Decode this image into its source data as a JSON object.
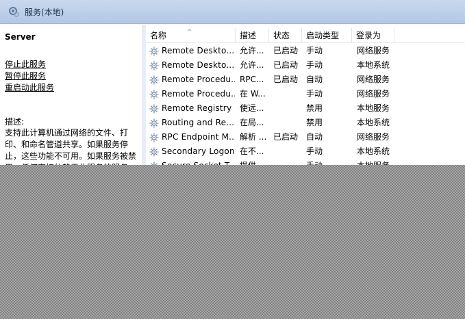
{
  "window": {
    "title": "服务(本地)"
  },
  "left_panel": {
    "service_name": "Server",
    "actions": [
      "停止此服务",
      "暂停此服务",
      "重启动此服务"
    ],
    "description_label": "描述:",
    "description_text": "支持此计算机通过网络的文件、打印、和命名管道共享。如果服务停止，这些功能不可用。如果服务被禁用，任何直接依赖于此服务的服务"
  },
  "table": {
    "columns": [
      "名称",
      "描述",
      "状态",
      "启动类型",
      "登录为"
    ],
    "rows": [
      {
        "name": "Remote Deskto...",
        "description": "允许...",
        "status": "已启动",
        "startup": "手动",
        "logon": "网络服务"
      },
      {
        "name": "Remote Deskto...",
        "description": "允许...",
        "status": "已启动",
        "startup": "手动",
        "logon": "本地系统"
      },
      {
        "name": "Remote Procedu...",
        "description": "RPC...",
        "status": "已启动",
        "startup": "自动",
        "logon": "网络服务"
      },
      {
        "name": "Remote Procedu...",
        "description": "在 W...",
        "status": "",
        "startup": "手动",
        "logon": "网络服务"
      },
      {
        "name": "Remote Registry",
        "description": "使远...",
        "status": "",
        "startup": "禁用",
        "logon": "本地服务"
      },
      {
        "name": "Routing and Re...",
        "description": "在局...",
        "status": "",
        "startup": "禁用",
        "logon": "本地系统"
      },
      {
        "name": "RPC Endpoint M...",
        "description": "解析 ...",
        "status": "已启动",
        "startup": "自动",
        "logon": "网络服务"
      },
      {
        "name": "Secondary Logon",
        "description": "在不...",
        "status": "",
        "startup": "手动",
        "logon": "本地系统"
      },
      {
        "name": "Secure Socket T...",
        "description": "提供...",
        "status": "",
        "startup": "手动",
        "logon": "本地服务"
      }
    ]
  },
  "icons": {
    "title": "services-icon",
    "row": "gear-icon"
  }
}
